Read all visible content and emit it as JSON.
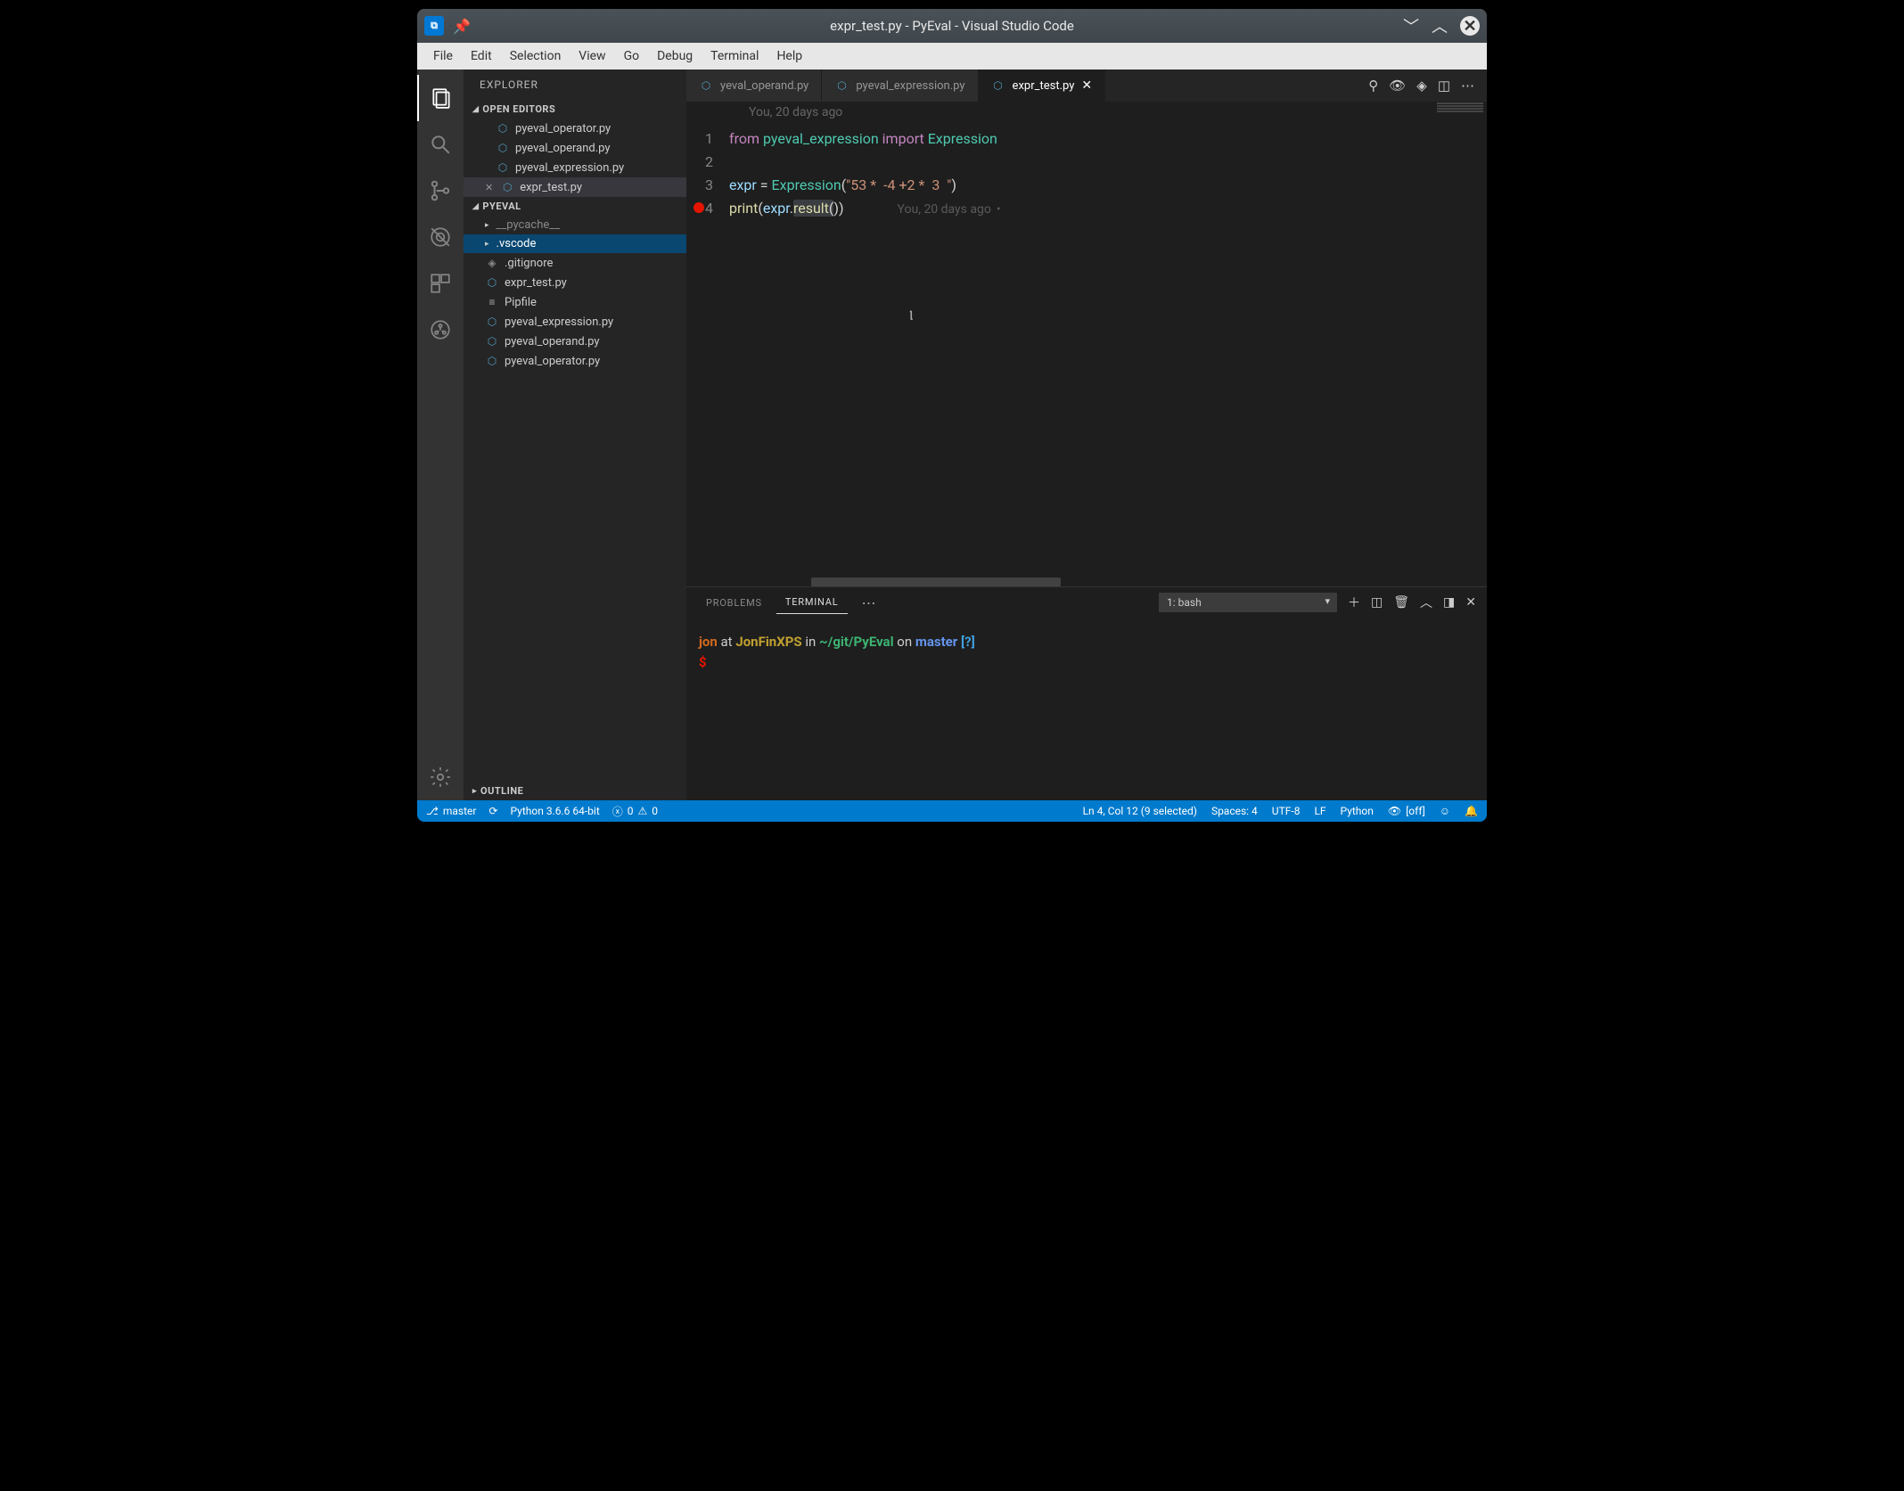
{
  "titlebar": {
    "title": "expr_test.py - PyEval - Visual Studio Code"
  },
  "menubar": [
    "File",
    "Edit",
    "Selection",
    "View",
    "Go",
    "Debug",
    "Terminal",
    "Help"
  ],
  "sidebar": {
    "title": "EXPLORER",
    "openEditorsHeader": "OPEN EDITORS",
    "openEditors": [
      {
        "name": "pyeval_operator.py",
        "modified": false
      },
      {
        "name": "pyeval_operand.py",
        "modified": false
      },
      {
        "name": "pyeval_expression.py",
        "modified": false
      },
      {
        "name": "expr_test.py",
        "modified": true
      }
    ],
    "projectHeader": "PYEVAL",
    "tree": [
      {
        "type": "folder",
        "name": "__pycache__",
        "dim": true
      },
      {
        "type": "folder",
        "name": ".vscode",
        "selected": true
      },
      {
        "type": "file",
        "name": ".gitignore",
        "icon": "git"
      },
      {
        "type": "file",
        "name": "expr_test.py",
        "icon": "py"
      },
      {
        "type": "file",
        "name": "Pipfile",
        "icon": "list"
      },
      {
        "type": "file",
        "name": "pyeval_expression.py",
        "icon": "py"
      },
      {
        "type": "file",
        "name": "pyeval_operand.py",
        "icon": "py"
      },
      {
        "type": "file",
        "name": "pyeval_operator.py",
        "icon": "py"
      }
    ],
    "outlineHeader": "OUTLINE"
  },
  "tabs": [
    {
      "label": "yeval_operand.py",
      "active": false,
      "close": false
    },
    {
      "label": "pyeval_expression.py",
      "active": false,
      "close": false
    },
    {
      "label": "expr_test.py",
      "active": true,
      "close": true
    }
  ],
  "editor": {
    "topBlame": "You, 20 days ago",
    "inlineBlame": "You, 20 days ago",
    "lines": {
      "l1_from": "from",
      "l1_mod": "pyeval_expression",
      "l1_import": "import",
      "l1_class": "Expression",
      "l3_pre": "expr = ",
      "l3_class": "Expression",
      "l3_str": "\"53 *  -4 +2 *  3  \"",
      "l4_func": "print",
      "l4_expr": "expr",
      "l4_method": "result",
      "l4_nums": [
        "1",
        "2",
        "3",
        "4"
      ]
    }
  },
  "panel": {
    "tabs": {
      "problems": "PROBLEMS",
      "terminal": "TERMINAL"
    },
    "terminalSelect": "1: bash",
    "prompt": {
      "user": "jon",
      "at": "at",
      "host": "JonFinXPS",
      "in": "in",
      "path": "~/git/PyEval",
      "on": "on",
      "branch": "master",
      "status": "[?]",
      "ps1": "$"
    }
  },
  "statusbar": {
    "branch": "master",
    "python": "Python 3.6.6 64-bit",
    "errors": "0",
    "warnings": "0",
    "cursor": "Ln 4, Col 12 (9 selected)",
    "spaces": "Spaces: 4",
    "encoding": "UTF-8",
    "eol": "LF",
    "language": "Python",
    "live": "[off]"
  }
}
